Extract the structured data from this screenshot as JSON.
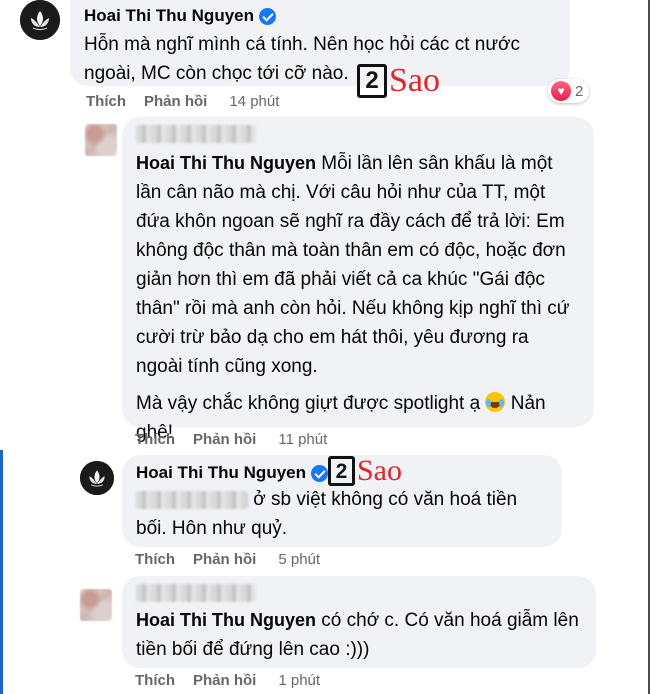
{
  "actions": {
    "like": "Thích",
    "reply": "Phản hồi"
  },
  "logo": {
    "number": "2",
    "word": "Sao"
  },
  "comments": [
    {
      "author": "Hoai Thi Thu Nguyen",
      "text": "Hỗn mà nghĩ mình cá tính. Nên học hỏi các ct nước ngoài, MC còn chọc tới cỡ nào.",
      "time": "14 phút",
      "reaction_count": "2"
    },
    {
      "mention": "Hoai Thi Thu Nguyen",
      "text": "Mỗi lần lên sân khấu là một lần cân não mà chị. Với câu hỏi như của TT, một đứa khôn ngoan sẽ nghĩ ra đầy cách để trả lời: Em không độc thân mà toàn thân em có độc, hoặc đơn giản hơn thì em đã phải viết cả ca khúc \"Gái độc thân\" rồi mà anh còn hỏi. Nếu không kịp nghĩ thì cứ cười trừ bảo dạ cho em hát thôi, yêu đương ra ngoài tính cũng xong.",
      "text2": "Mà vậy chắc không giựt được spotlight ạ",
      "text2_end": "Nản ghê!",
      "emoji": "tears-of-joy-emoji",
      "time": "11 phút"
    },
    {
      "author": "Hoai Thi Thu Nguyen",
      "text": "ở sb việt không có văn hoá tiền bối. Hôn như quỷ.",
      "time": "5 phút"
    },
    {
      "mention": "Hoai Thi Thu Nguyen",
      "text": "có chớ c. Có văn hoá giẫm lên tiền bối để đứng lên cao :)))",
      "time": "1 phút"
    }
  ]
}
